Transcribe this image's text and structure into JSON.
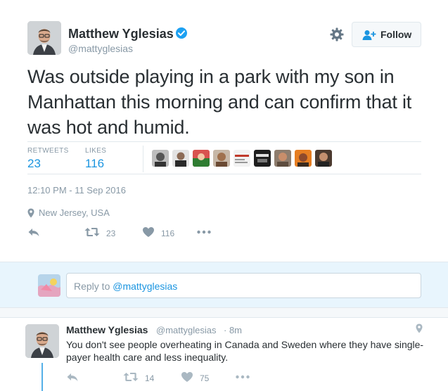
{
  "tweet": {
    "display_name": "Matthew Yglesias",
    "screen_name": "@mattyglesias",
    "follow_label": "Follow",
    "text": "Was outside playing in a park with my son in Manhattan this morning and can confirm that it was hot and humid.",
    "stats": {
      "retweets_label": "RETWEETS",
      "retweets_value": "23",
      "likes_label": "LIKES",
      "likes_value": "116"
    },
    "likers_count_shown": 9,
    "timestamp": "12:10 PM - 11 Sep 2016",
    "location": "New Jersey, USA",
    "actions": {
      "retweet_count": "23",
      "like_count": "116"
    }
  },
  "reply": {
    "prefix": "Reply to ",
    "mention": "@mattyglesias"
  },
  "reply_tweet": {
    "display_name": "Matthew Yglesias",
    "screen_name": "@mattyglesias",
    "time": "· 8m",
    "text": "You don't see people overheating in Canada and Sweden where they have single-payer health care and less inequality.",
    "retweet_count": "14",
    "like_count": "75"
  },
  "colors": {
    "accent": "#1b95e0",
    "muted": "#8899a6",
    "text": "#292f33",
    "reply_bg": "#e8f5fd"
  },
  "icons": [
    "verified-badge-icon",
    "gear-icon",
    "follow-person-icon",
    "map-pin-icon",
    "reply-icon",
    "retweet-icon",
    "heart-icon",
    "more-icon"
  ]
}
